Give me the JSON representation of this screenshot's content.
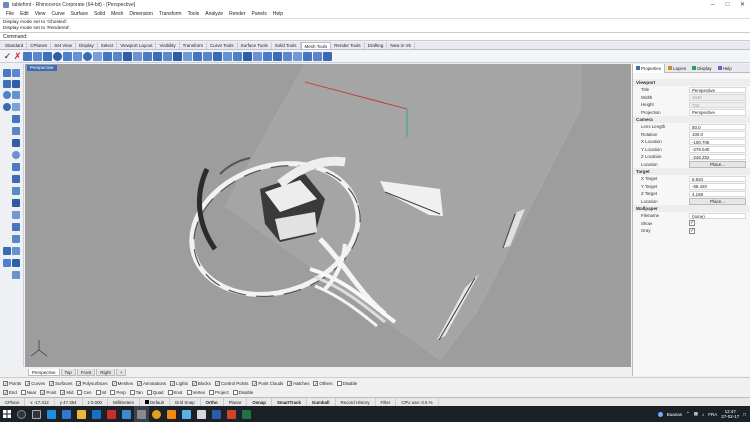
{
  "window": {
    "title": "tablefont - Rhinoceros Corporate (64-bit) - [Perspective]"
  },
  "menu": [
    "File",
    "Edit",
    "View",
    "Curve",
    "Surface",
    "Solid",
    "Mesh",
    "Dimension",
    "Transform",
    "Tools",
    "Analyze",
    "Render",
    "Panels",
    "Help"
  ],
  "history": [
    "Display mode set to 'Ghosted'.",
    "Display mode set to 'Rendered'."
  ],
  "command": {
    "label": "Command:"
  },
  "tabs": [
    "Standard",
    "CPlanes",
    "Set View",
    "Display",
    "Select",
    "Viewport Layout",
    "Visibility",
    "Transform",
    "Curve Tools",
    "Surface Tools",
    "Solid Tools",
    "Mesh Tools",
    "Render Tools",
    "Drafting",
    "New in V5"
  ],
  "active_tab": "Mesh Tools",
  "viewport": {
    "label": "Perspective",
    "tabs": [
      "Perspective",
      "Top",
      "Front",
      "Right"
    ],
    "add_icon": "+"
  },
  "panel": {
    "tabs": [
      "Properties",
      "Layers",
      "Display",
      "Help"
    ],
    "viewport_section": "Viewport",
    "viewport_rows": [
      {
        "k": "Title",
        "v": "Perspective",
        "dis": false
      },
      {
        "k": "Width",
        "v": "1040",
        "dis": true
      },
      {
        "k": "Height",
        "v": "702",
        "dis": true
      },
      {
        "k": "Projection",
        "v": "Perspective",
        "dis": false
      }
    ],
    "camera_section": "Camera",
    "camera_rows": [
      {
        "k": "Lens Length",
        "v": "50.0"
      },
      {
        "k": "Rotation",
        "v": "100.0"
      },
      {
        "k": "X Location",
        "v": "-100.706"
      },
      {
        "k": "Y Location",
        "v": "-278.040"
      },
      {
        "k": "Z Location",
        "v": "-248.252"
      }
    ],
    "location_label": "Location",
    "place_label": "Place...",
    "target_section": "Target",
    "target_rows": [
      {
        "k": "X Target",
        "v": "6.934"
      },
      {
        "k": "Y Target",
        "v": "-65.420"
      },
      {
        "k": "Z Target",
        "v": "4.169"
      }
    ],
    "wallpaper_section": "Wallpaper",
    "filename_label": "Filename",
    "filename_value": "(none)",
    "show_label": "Show",
    "gray_label": "Gray"
  },
  "osnap_row1": [
    "Points",
    "Curves",
    "Surfaces",
    "Polysurfaces",
    "Meshes",
    "Annotations",
    "Lights",
    "Blocks",
    "Control Points",
    "Point Clouds",
    "Hatches",
    "Others",
    "Disable"
  ],
  "osnap_row2": [
    "End",
    "Near",
    "Point",
    "Mid",
    "Cen",
    "Int",
    "Perp",
    "Tan",
    "Quad",
    "Knot",
    "Vertex",
    "Project",
    "Disable"
  ],
  "status": {
    "cplane": "CPlane",
    "x": "x -17.312",
    "y": "y 47.354",
    "z": "z 0.000",
    "units": "Millimeters",
    "layer": "Default",
    "toggles": [
      "Grid Snap",
      "Ortho",
      "Planar",
      "Osnap",
      "SmartTrack",
      "Gumball",
      "Record History",
      "Filter"
    ],
    "cpu": "CPU use: 0.5 %"
  },
  "taskbar": {
    "tray_text": "Buanas",
    "lang": "FRA",
    "time": "12:47",
    "date": "27-02-17"
  },
  "colors": {
    "accent": "#3d6ab0",
    "viewport_bg": "#9d9d9d",
    "grid": "#a9a9a9",
    "taskbar": "#1c2128"
  }
}
